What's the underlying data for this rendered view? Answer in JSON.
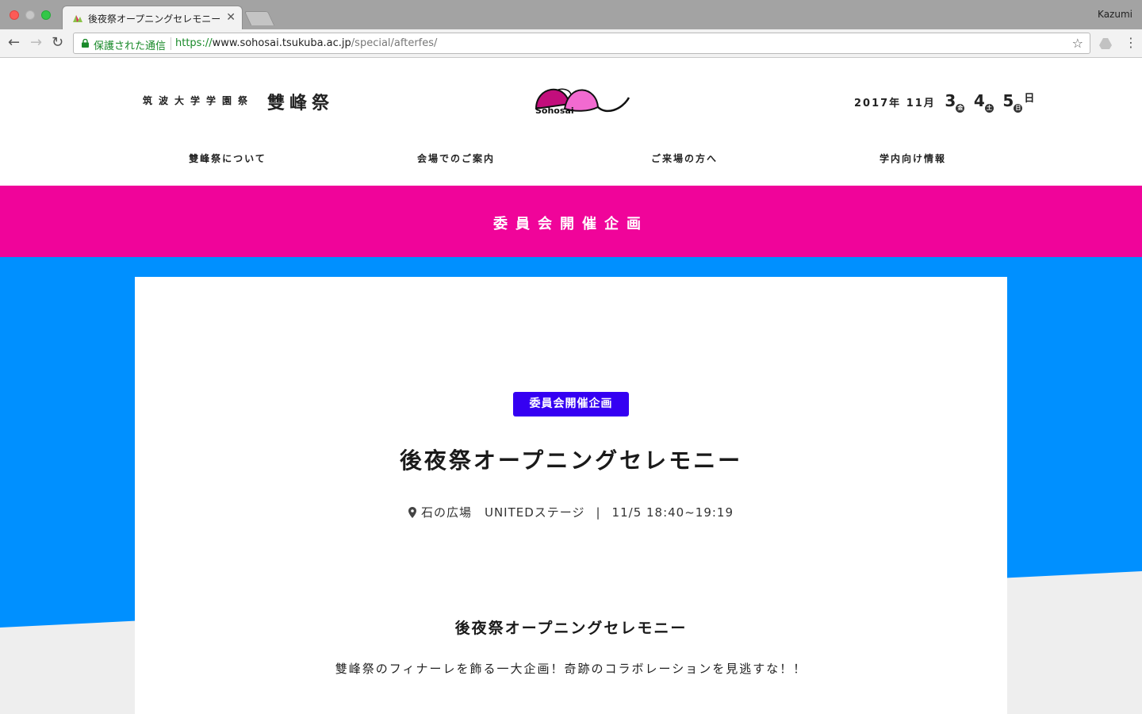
{
  "browser": {
    "tab_title": "後夜祭オープニングセレモニー",
    "tab_close": "✕",
    "profile_name": "Kazumi",
    "secure_label": "保護された通信",
    "url_scheme": "https://",
    "url_host": "www.sohosai.tsukuba.ac.jp",
    "url_path": "/special/afterfes/",
    "back_icon": "←",
    "forward_icon": "→",
    "reload_icon": "↻",
    "star_icon": "☆",
    "menu_icon": "⋮"
  },
  "header": {
    "brand_sub": "筑波大学学園祭",
    "brand_main": "雙峰祭",
    "logo_text": "Sohosai",
    "date": {
      "year_month": "2017年 11月",
      "days": [
        {
          "day": "3",
          "dow": "金"
        },
        {
          "day": "4",
          "dow": "土"
        },
        {
          "day": "5",
          "dow": "日"
        }
      ],
      "suffix": "日"
    },
    "nav": [
      "雙峰祭について",
      "会場でのご案内",
      "ご来場の方へ",
      "学内向け情報"
    ]
  },
  "banner": {
    "title": "委員会開催企画"
  },
  "event": {
    "badge": "委員会開催企画",
    "title": "後夜祭オープニングセレモニー",
    "location": "石の広場　UNITEDステージ",
    "separator": "|",
    "time": "11/5 18:40~19:19",
    "section_title": "後夜祭オープニングセレモニー",
    "description": "雙峰祭のフィナーレを飾る一大企画！奇跡のコラボレーションを見逃すな！！"
  },
  "colors": {
    "banner": "#f0049a",
    "badge": "#3500f2",
    "blue_bg": "#0090ff",
    "gray_bg": "#eeeeee"
  }
}
